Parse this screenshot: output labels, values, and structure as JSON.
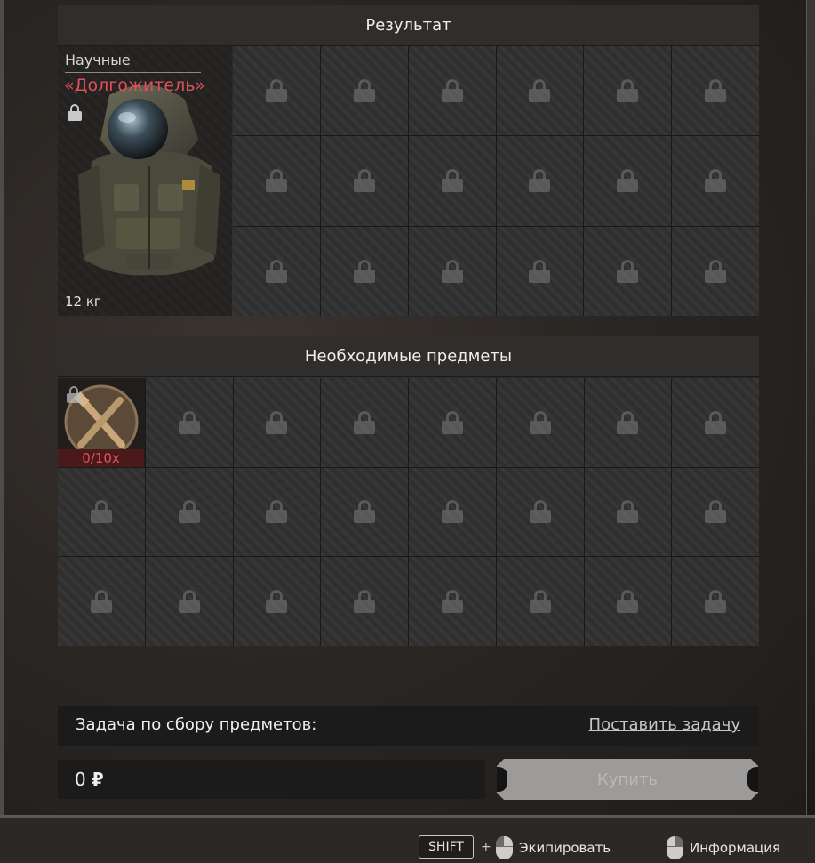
{
  "result_section": {
    "title": "Результат",
    "item": {
      "category": "Научные",
      "name": "«Долгожитель»",
      "weight": "12 кг"
    }
  },
  "required_section": {
    "title": "Необходимые предметы",
    "first_item_count": "0/10x"
  },
  "task": {
    "label": "Задача по сбору предметов:",
    "action": "Поставить задачу"
  },
  "purchase": {
    "price": "0",
    "currency": "₽",
    "buy_label": "Купить"
  },
  "footer": {
    "shift_key": "SHIFT",
    "plus": "+",
    "equip_label": "Экипировать",
    "info_label": "Информация"
  },
  "colors": {
    "item_name": "#e0505a",
    "required_count": "#e0505a",
    "button_disabled": "#9c9b9a"
  }
}
